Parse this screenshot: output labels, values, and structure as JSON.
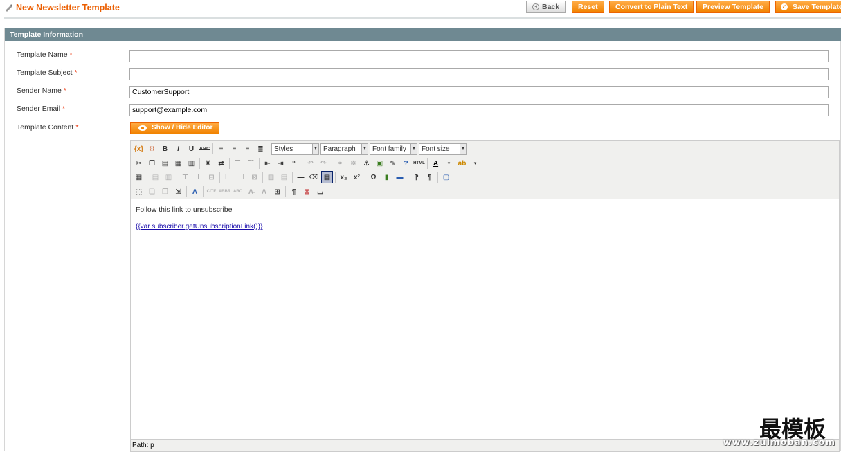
{
  "header": {
    "title": "New Newsletter Template",
    "buttons": {
      "back": "Back",
      "reset": "Reset",
      "convert": "Convert to Plain Text",
      "preview": "Preview Template",
      "save": "Save Template"
    }
  },
  "section": {
    "title": "Template Information",
    "fields": {
      "template_name": {
        "label": "Template Name",
        "value": ""
      },
      "template_subject": {
        "label": "Template Subject",
        "value": ""
      },
      "sender_name": {
        "label": "Sender Name",
        "value": "CustomerSupport"
      },
      "sender_email": {
        "label": "Sender Email",
        "value": "support@example.com"
      },
      "template_content": {
        "label": "Template Content"
      }
    },
    "required_mark": "*",
    "show_hide_label": "Show / Hide Editor"
  },
  "editor": {
    "selects": {
      "styles": "Styles",
      "format": "Paragraph",
      "font_family": "Font family",
      "font_size": "Font size"
    },
    "content": {
      "line1": "Follow this link to unsubscribe",
      "link": "{{var subscriber.getUnsubscriptionLink()}}"
    },
    "status_path": "Path: p"
  },
  "watermark": {
    "main": "最模板",
    "sub": "www.zuimoban.com"
  },
  "colors": {
    "accent": "#eb5e00",
    "button": "#f18200",
    "section_header": "#6f8992"
  }
}
